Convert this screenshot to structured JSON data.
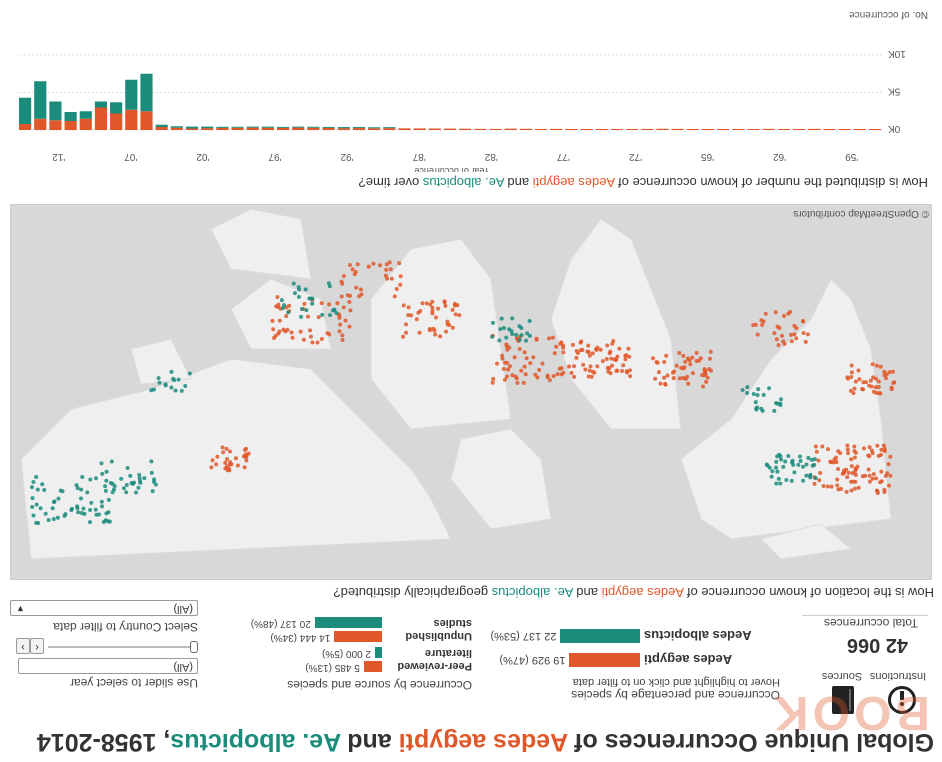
{
  "header": {
    "title_parts": [
      {
        "text": "Global Unique Occurrences of ",
        "color": "#333333"
      },
      {
        "text": "Aedes aegypti",
        "color": "#e0582a"
      },
      {
        "text": " and ",
        "color": "#333333"
      },
      {
        "text": "Ae. albopictus",
        "color": "#1b8c7c"
      },
      {
        "text": ",  1958-2014",
        "color": "#333333"
      }
    ]
  },
  "info": {
    "instructions_label": "Instructions",
    "sources_label": "Sources",
    "total_value": "42 066",
    "total_label": "Total occurrences"
  },
  "species_panel": {
    "heading": "Occurrence and percentage by species",
    "hint": "Hover to highlight and click on to filter data",
    "rows": [
      {
        "label": "Aedes aegypti",
        "value": "19 929 (47%)",
        "color": "#e0582a",
        "frac": 0.47
      },
      {
        "label": "Aedes albopictus",
        "value": "22 137 (53%)",
        "color": "#1b8c7c",
        "frac": 0.53
      }
    ]
  },
  "source_panel": {
    "heading": "Occurrence by source and species",
    "rows": [
      {
        "label": "Peer-reviewed literature",
        "orange": "5 485 (13%)",
        "teal": "2 000 (5%)",
        "o_frac": 0.13,
        "t_frac": 0.05
      },
      {
        "label": "Unpublished studies",
        "orange": "14 444 (34%)",
        "teal": "20 137 (48%)",
        "o_frac": 0.34,
        "t_frac": 0.48
      }
    ]
  },
  "filters": {
    "year_label": "Use slider to select year",
    "year_value": "(All)",
    "country_label": "Select Country to filter data",
    "country_value": "(All)"
  },
  "map": {
    "question_parts": [
      {
        "text": "How is the location of known occurrence of ",
        "color": "#333333"
      },
      {
        "text": "Aedes aegypti",
        "color": "#e0582a"
      },
      {
        "text": " and ",
        "color": "#333333"
      },
      {
        "text": "Ae. albopictus",
        "color": "#1b8c7c"
      },
      {
        "text": " geographically distributed?",
        "color": "#333333"
      }
    ],
    "attribution": "© OpenStreetMap contributors"
  },
  "timeline": {
    "question_parts": [
      {
        "text": "How is distributed the number of known occurrence of ",
        "color": "#333333"
      },
      {
        "text": "Aedes aegypti",
        "color": "#e0582a"
      },
      {
        "text": " and ",
        "color": "#333333"
      },
      {
        "text": "Ae. albopictus",
        "color": "#1b8c7c"
      },
      {
        "text": " over time?",
        "color": "#333333"
      }
    ]
  },
  "chart_data": {
    "type": "bar",
    "xlabel": "Year of occurrence",
    "ylabel": "No. of occurrence",
    "x_ticks": [
      "'59",
      "'62",
      "'65",
      "'72",
      "'77",
      "'82",
      "'87",
      "'92",
      "'97",
      "'02",
      "'07",
      "'12"
    ],
    "y_ticks": [
      "0K",
      "5K",
      "10K"
    ],
    "ylim": [
      0,
      10000
    ],
    "stacked": true,
    "x": [
      "1958",
      "1959",
      "1960",
      "1961",
      "1962",
      "1963",
      "1964",
      "1965",
      "1966",
      "1967",
      "1968",
      "1969",
      "1970",
      "1971",
      "1972",
      "1973",
      "1974",
      "1975",
      "1976",
      "1977",
      "1978",
      "1979",
      "1980",
      "1981",
      "1982",
      "1983",
      "1984",
      "1985",
      "1986",
      "1987",
      "1988",
      "1989",
      "1990",
      "1991",
      "1992",
      "1993",
      "1994",
      "1995",
      "1996",
      "1997",
      "1998",
      "1999",
      "2000",
      "2001",
      "2002",
      "2003",
      "2004",
      "2005",
      "2006",
      "2007",
      "2008",
      "2009",
      "2010",
      "2011",
      "2012",
      "2013",
      "2014"
    ],
    "series": [
      {
        "name": "Aedes aegypti",
        "color": "#e0582a",
        "values": [
          50,
          60,
          80,
          100,
          150,
          120,
          130,
          150,
          110,
          140,
          120,
          100,
          120,
          150,
          160,
          140,
          120,
          110,
          100,
          90,
          130,
          150,
          140,
          160,
          180,
          140,
          150,
          170,
          190,
          200,
          210,
          220,
          250,
          230,
          260,
          240,
          280,
          300,
          320,
          280,
          300,
          320,
          300,
          280,
          250,
          200,
          300,
          400,
          2500,
          2700,
          2200,
          3000,
          1500,
          1200,
          1300,
          1500,
          800
        ],
        "color_note": "orange"
      },
      {
        "name": "Ae. albopictus",
        "color": "#1b8c7c",
        "values": [
          0,
          0,
          0,
          0,
          0,
          0,
          0,
          0,
          0,
          0,
          0,
          0,
          0,
          0,
          0,
          0,
          0,
          0,
          0,
          0,
          0,
          0,
          0,
          0,
          0,
          0,
          0,
          0,
          0,
          0,
          0,
          0,
          50,
          80,
          100,
          150,
          120,
          100,
          80,
          120,
          150,
          100,
          120,
          150,
          200,
          250,
          200,
          300,
          5000,
          4000,
          1500,
          800,
          1000,
          1200,
          2500,
          5000,
          3500
        ]
      }
    ]
  }
}
